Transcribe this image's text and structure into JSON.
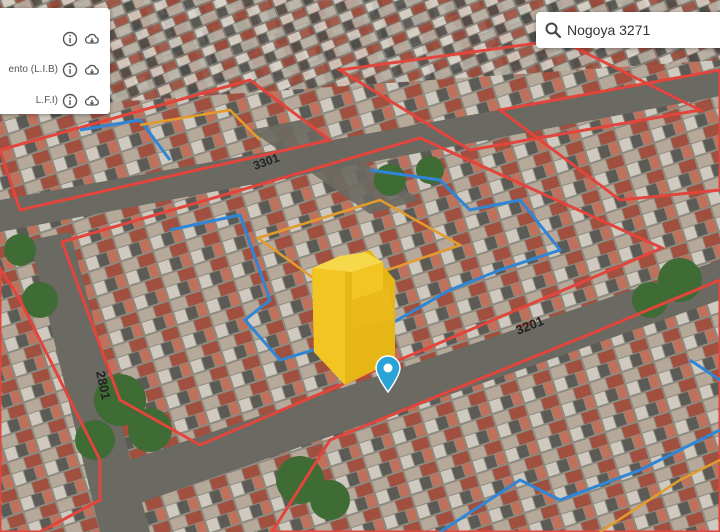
{
  "search": {
    "value": "Nogoya 3271"
  },
  "layers": [
    {
      "label": "",
      "info_icon": "info-icon",
      "download_icon": "cloud-download-icon"
    },
    {
      "label": "ento (L.I.B)",
      "info_icon": "info-icon",
      "download_icon": "cloud-download-icon"
    },
    {
      "label": "L.F.I)",
      "info_icon": "info-icon",
      "download_icon": "cloud-download-icon"
    }
  ],
  "street_labels": [
    "3201",
    "2801",
    "3301"
  ],
  "colors": {
    "block_outline": "#e2453c",
    "parcel_outline": "#2f86d6",
    "lot_outline": "#e59b2b",
    "building": "#f2c523",
    "marker": "#2aa4d6"
  }
}
